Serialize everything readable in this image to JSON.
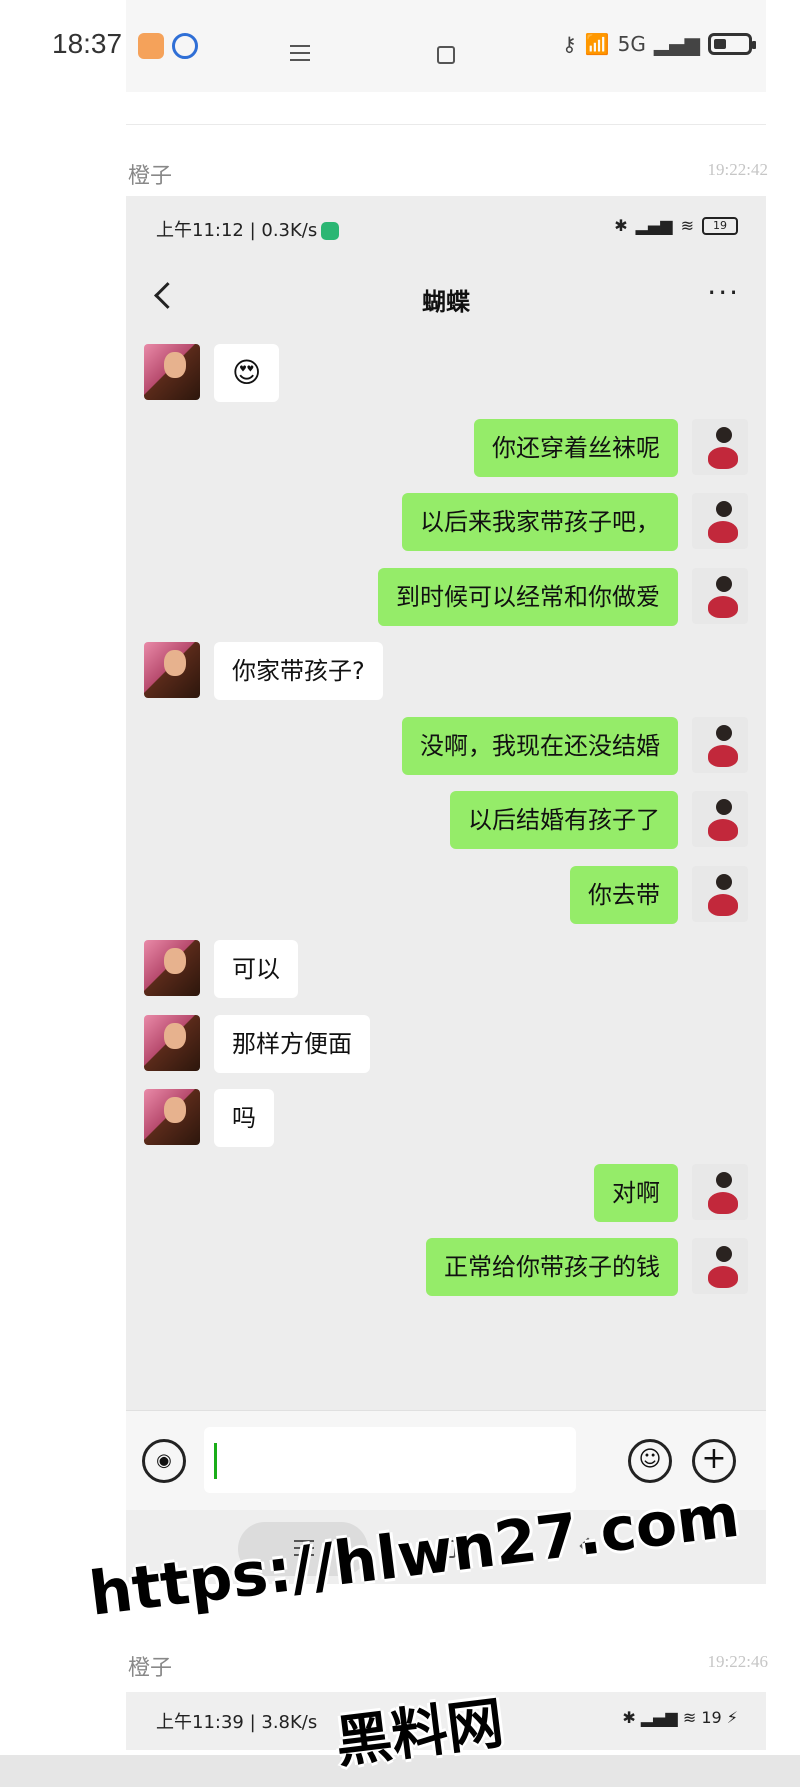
{
  "outer_status": {
    "time": "18:37",
    "signal_label": "5G",
    "icons": [
      "key-icon",
      "wifi-icon",
      "signal-icon",
      "battery-icon"
    ]
  },
  "forward_entry_1": {
    "sender": "橙子",
    "time": "19:22:42"
  },
  "inner": {
    "status_left": "上午11:12 | 0.3K/s",
    "battery": "19",
    "chat_title": "蝴蝶",
    "more_label": "···",
    "messages": [
      {
        "side": "left",
        "text": "😍"
      },
      {
        "side": "right",
        "text": "你还穿着丝袜呢"
      },
      {
        "side": "right",
        "text": "以后来我家带孩子吧，"
      },
      {
        "side": "right",
        "text": "到时候可以经常和你做爱"
      },
      {
        "side": "left",
        "text": "你家带孩子?"
      },
      {
        "side": "right",
        "text": "没啊，我现在还没结婚"
      },
      {
        "side": "right",
        "text": "以后结婚有孩子了"
      },
      {
        "side": "right",
        "text": "你去带"
      },
      {
        "side": "left",
        "text": "可以"
      },
      {
        "side": "left",
        "text": "那样方便面"
      },
      {
        "side": "left",
        "text": "吗"
      },
      {
        "side": "right",
        "text": "对啊"
      },
      {
        "side": "right",
        "text": "正常给你带孩子的钱"
      }
    ],
    "input": {
      "value": ""
    }
  },
  "forward_entry_2": {
    "sender": "橙子",
    "time": "19:22:46"
  },
  "next_status": {
    "left": "上午11:39 | 3.8K/s",
    "battery": "19"
  },
  "watermark": {
    "url": "https://hlwn27.com",
    "name": "黑料网"
  },
  "colors": {
    "sent_bubble": "#95ec69",
    "received_bubble": "#ffffff",
    "chat_bg": "#ededed"
  }
}
